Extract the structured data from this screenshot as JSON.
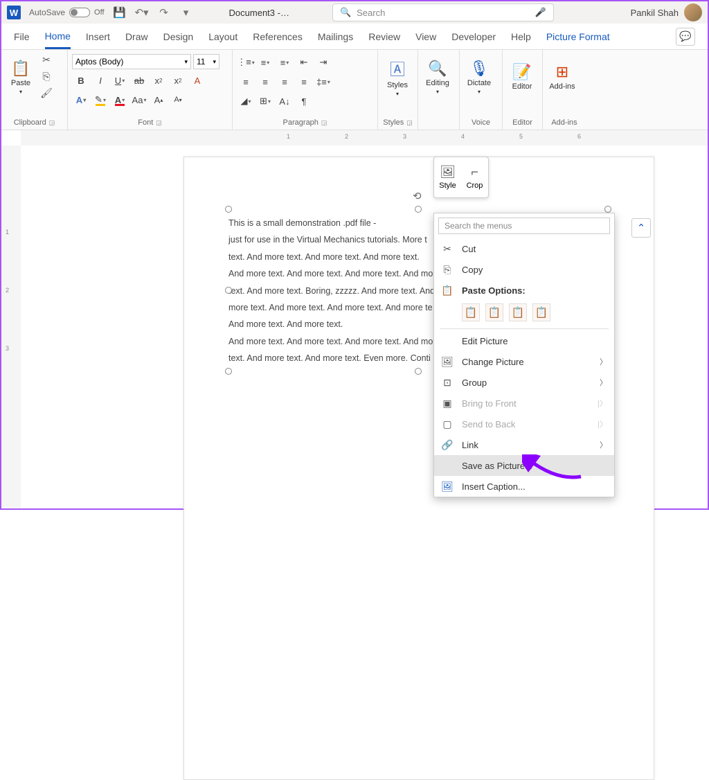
{
  "titlebar": {
    "autosave_label": "AutoSave",
    "autosave_state": "Off",
    "doc_title": "Document3 -…",
    "search_placeholder": "Search",
    "user_name": "Pankil Shah"
  },
  "tabs": [
    "File",
    "Home",
    "Insert",
    "Draw",
    "Design",
    "Layout",
    "References",
    "Mailings",
    "Review",
    "View",
    "Developer",
    "Help",
    "Picture Format"
  ],
  "active_tab": "Home",
  "ribbon": {
    "clipboard": {
      "label": "Clipboard",
      "paste": "Paste"
    },
    "font": {
      "label": "Font",
      "name": "Aptos (Body)",
      "size": "11"
    },
    "paragraph": {
      "label": "Paragraph"
    },
    "styles": {
      "label": "Styles",
      "btn": "Styles"
    },
    "editing": {
      "label": "",
      "btn": "Editing"
    },
    "voice": {
      "label": "Voice",
      "btn": "Dictate"
    },
    "editor": {
      "label": "Editor",
      "btn": "Editor"
    },
    "addins": {
      "label": "Add-ins",
      "btn": "Add-ins"
    }
  },
  "document_text": [
    "This is a small demonstration .pdf file -",
    "just for use in the Virtual Mechanics tutorials. More t",
    "text. And more text. And more text. And more text.",
    "And more text. And more text. And more text. And mo",
    "text. And more text. Boring, zzzzz. And more text. And",
    "more text. And more text. And more text. And more te",
    "And more text. And more text.",
    "And more text. And more text. And more text. And mo",
    "text. And more text. And more text. Even more. Conti"
  ],
  "mini_toolbar": {
    "style": "Style",
    "crop": "Crop"
  },
  "context_menu": {
    "search_placeholder": "Search the menus",
    "cut": "Cut",
    "copy": "Copy",
    "paste_options": "Paste Options:",
    "edit_picture": "Edit Picture",
    "change_picture": "Change Picture",
    "group": "Group",
    "bring_front": "Bring to Front",
    "send_back": "Send to Back",
    "link": "Link",
    "save_as_picture": "Save as Picture...",
    "insert_caption": "Insert Caption..."
  },
  "ruler_marks": [
    "1",
    "2",
    "3",
    "4",
    "5",
    "6"
  ],
  "vruler_marks": [
    "1",
    "2",
    "3"
  ]
}
